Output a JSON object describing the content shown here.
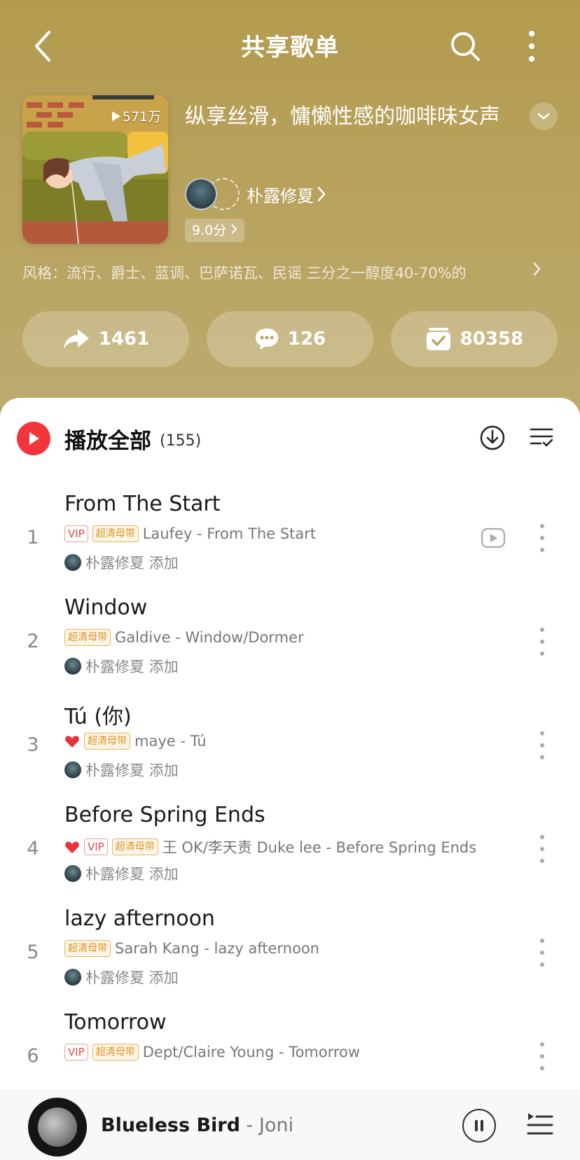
{
  "header": {
    "title": "共享歌单"
  },
  "playlist": {
    "play_count": "571万",
    "title": "纵享丝滑，慵懒性感的咖啡味女声",
    "creator": "朴露修夏",
    "score": "9.0分",
    "styles": "风格：流行、爵士、蓝调、巴萨诺瓦、民谣  三分之一醇度40-70%的"
  },
  "actions": {
    "share_count": "1461",
    "comment_count": "126",
    "collect_count": "80358"
  },
  "list": {
    "play_all_label": "播放全部",
    "count": "(155)",
    "songs": [
      {
        "index": "1",
        "title": "From The Start",
        "vip": "VIP",
        "hq": "超清母带",
        "meta": "Laufey - From The Start",
        "added": "朴露修夏 添加"
      },
      {
        "index": "2",
        "title": "Window",
        "hq": "超清母带",
        "meta": "Galdive - Window/Dormer",
        "added": "朴露修夏 添加"
      },
      {
        "index": "3",
        "title": "Tú (你)",
        "hq": "超清母带",
        "meta": "maye - Tú",
        "added": "朴露修夏 添加"
      },
      {
        "index": "4",
        "title": "Before Spring Ends",
        "vip": "VIP",
        "hq": "超清母带",
        "meta": "王 OK/李天责 Duke lee - Before Spring Ends",
        "added": "朴露修夏 添加"
      },
      {
        "index": "5",
        "title": "lazy afternoon",
        "hq": "超清母带",
        "meta": "Sarah Kang - lazy afternoon",
        "added": "朴露修夏 添加"
      },
      {
        "index": "6",
        "title": "Tomorrow",
        "vip": "VIP",
        "hq": "超清母带",
        "meta": "Dept/Claire Young - Tomorrow",
        "added": ""
      }
    ]
  },
  "player": {
    "title": "Blueless Bird",
    "artist": " - Joni"
  },
  "colors": {
    "header_bg": "#b39b4e",
    "accent_red": "#f2353b",
    "vip_red": "#e6474c",
    "hq_gold": "#d89425"
  }
}
